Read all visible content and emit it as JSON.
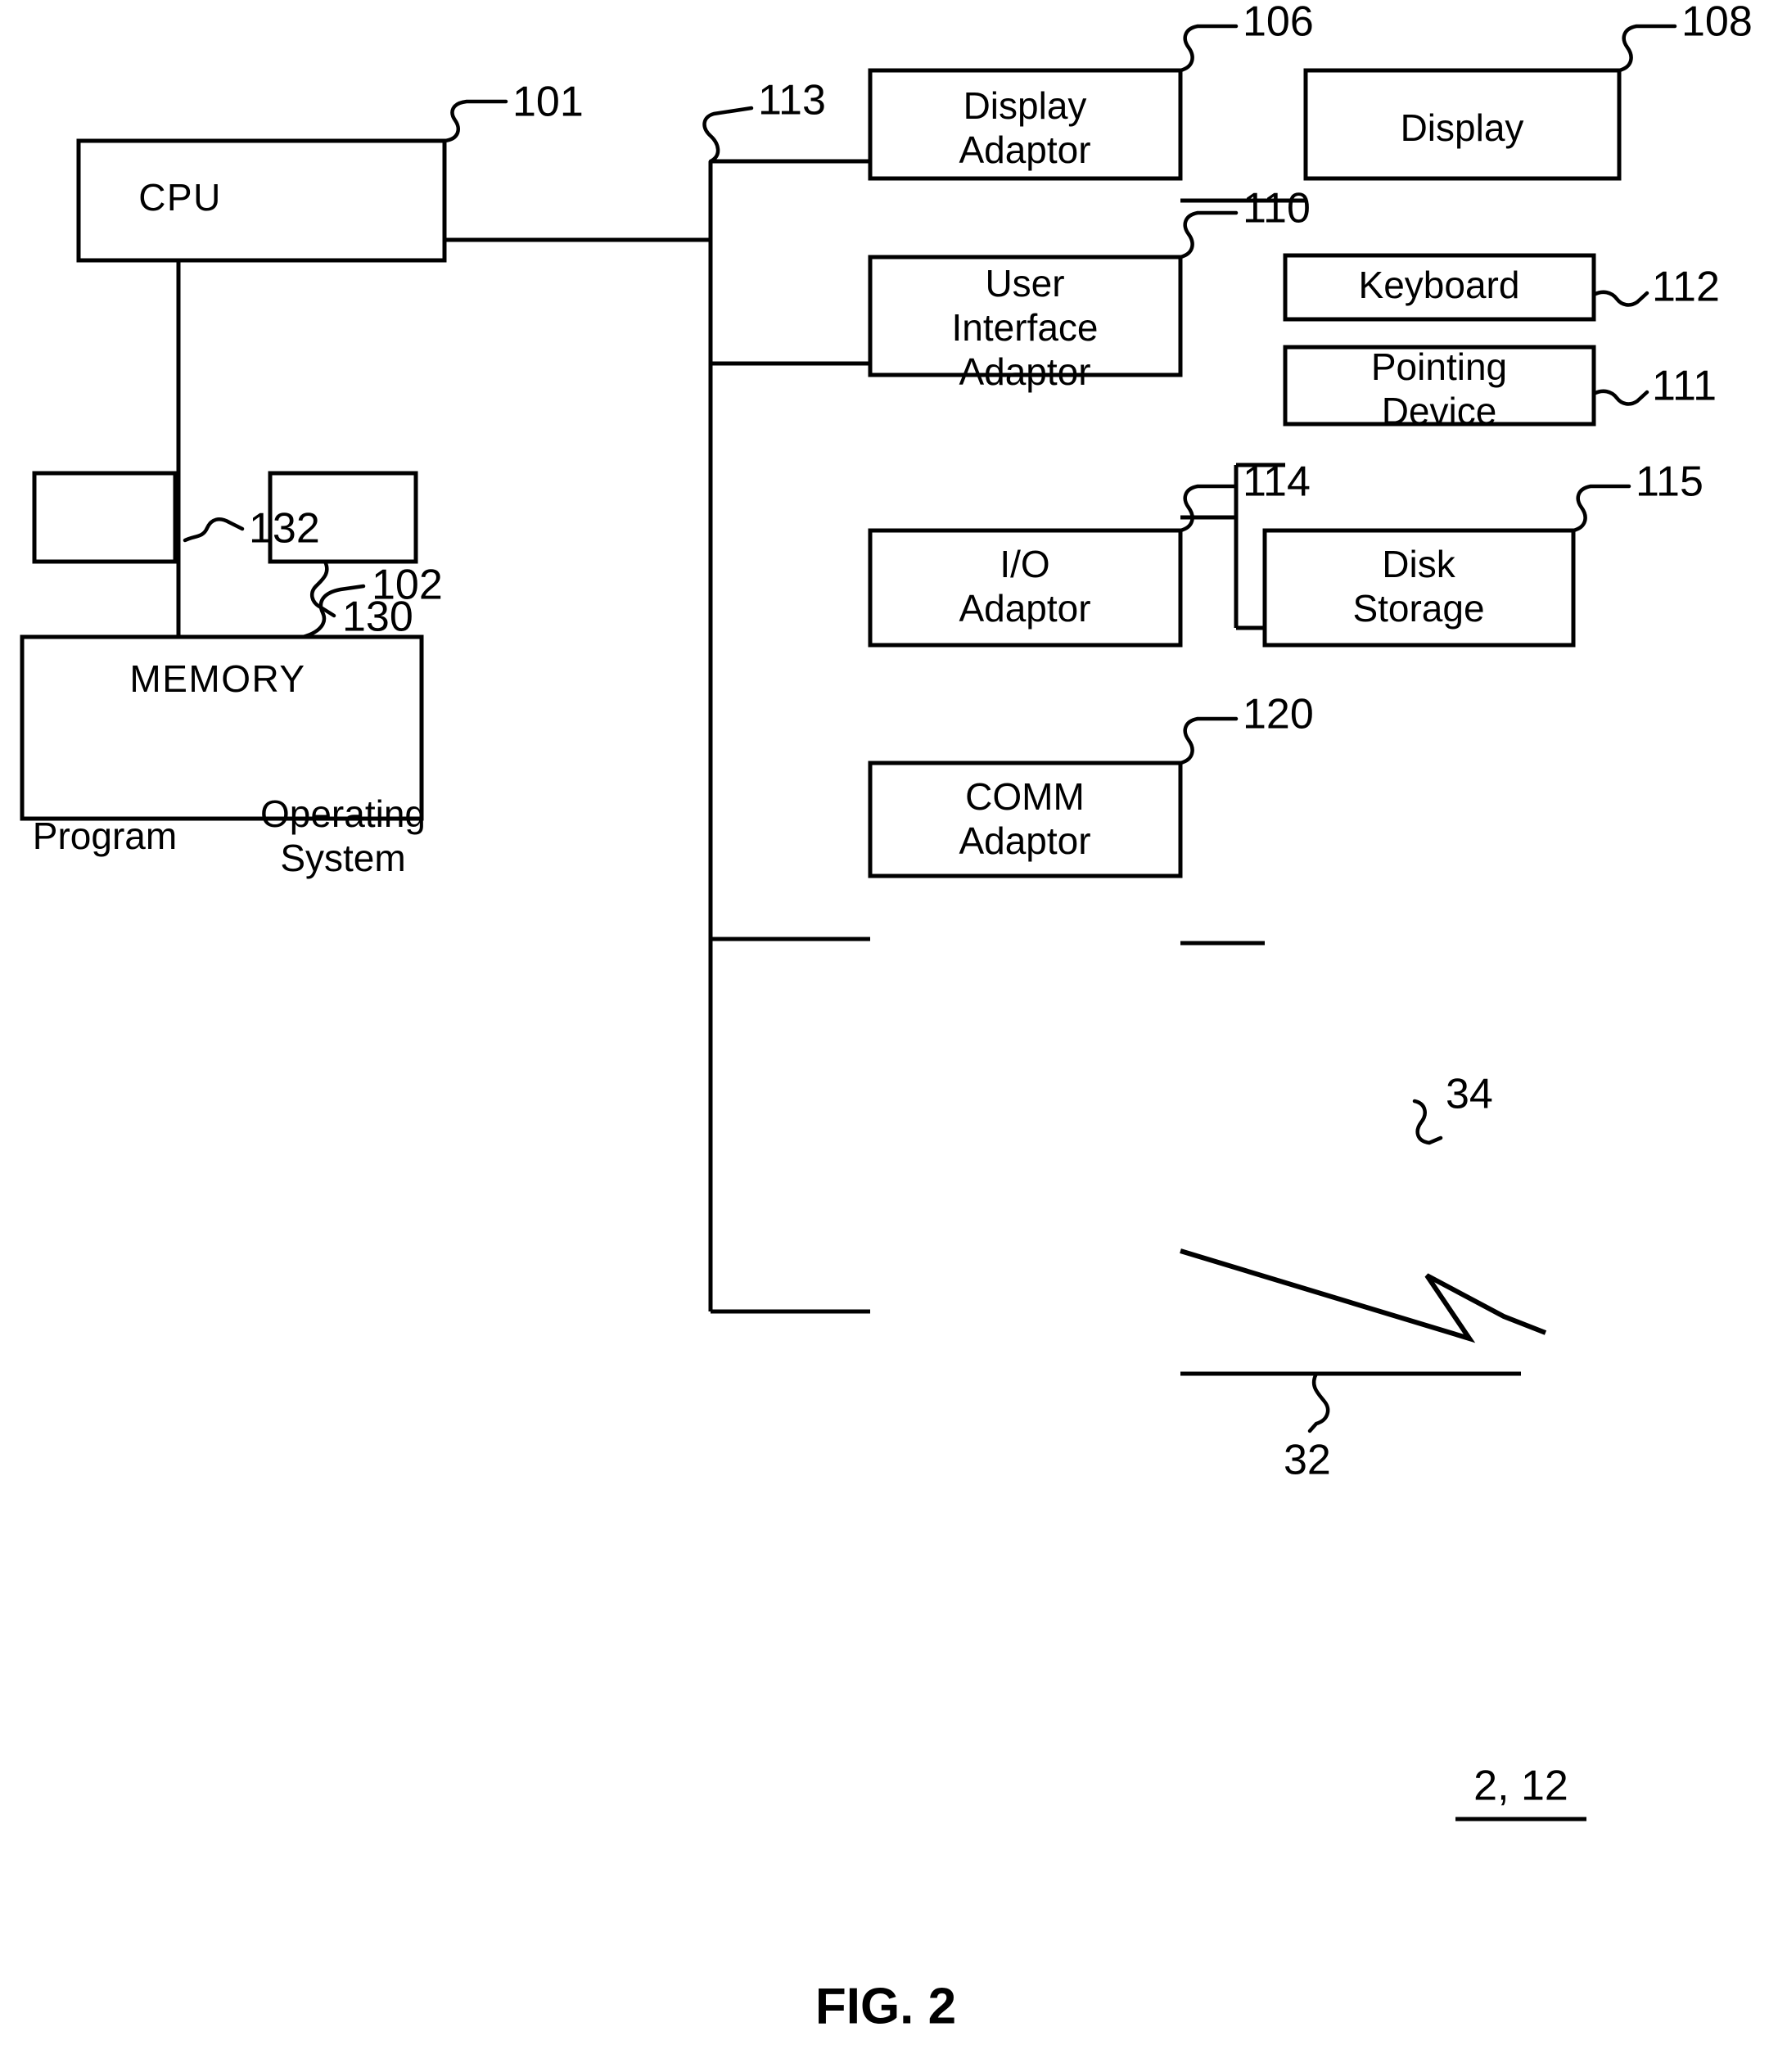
{
  "figure": {
    "caption": "FIG. 2",
    "system_ref": "2, 12"
  },
  "blocks": {
    "cpu": {
      "label": "CPU",
      "ref": "101"
    },
    "memory": {
      "label": "MEMORY",
      "ref": "102"
    },
    "program": {
      "label": "Program",
      "ref": "132"
    },
    "operating_system": {
      "label_line1": "Operating",
      "label_line2": "System",
      "ref": "130"
    },
    "display_adaptor": {
      "label_line1": "Display",
      "label_line2": "Adaptor",
      "ref": "113"
    },
    "display": {
      "label": "Display",
      "ref": "108"
    },
    "display_adaptor_ref_top": {
      "ref": "106"
    },
    "user_interface_adaptor": {
      "label_line1": "User",
      "label_line2": "Interface",
      "label_line3": "Adaptor",
      "ref": "110"
    },
    "keyboard": {
      "label": "Keyboard",
      "ref": "112"
    },
    "pointing_device": {
      "label_line1": "Pointing",
      "label_line2": "Device",
      "ref": "111"
    },
    "io_adaptor": {
      "label_line1": "I/O",
      "label_line2": "Adaptor",
      "ref": "114"
    },
    "disk_storage": {
      "label_line1": "Disk",
      "label_line2": "Storage",
      "ref": "115"
    },
    "comm_adaptor": {
      "label_line1": "COMM",
      "label_line2": "Adaptor",
      "ref": "120"
    }
  },
  "connections": {
    "wireless_link_ref": "34",
    "wired_link_ref": "32"
  },
  "colors": {
    "stroke": "#000000",
    "fill": "#ffffff",
    "background": "#ffffff"
  }
}
